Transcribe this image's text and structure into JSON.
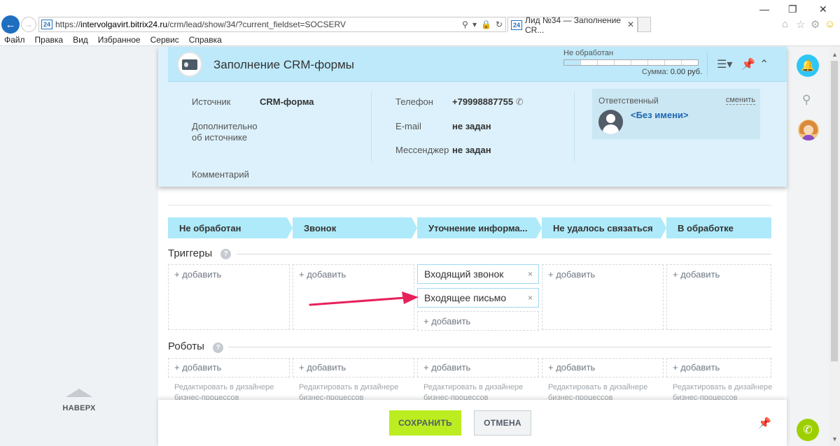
{
  "browser": {
    "url_prefix": "https://",
    "url_host": "intervolgavirt.bitrix24.ru",
    "url_path": "/crm/lead/show/34/?current_fieldset=SOCSERV",
    "favicon_text": "24",
    "tab_title": "Лид №34 — Заполнение CR...",
    "menu": [
      "Файл",
      "Правка",
      "Вид",
      "Избранное",
      "Сервис",
      "Справка"
    ]
  },
  "header": {
    "title": "Заполнение CRM-формы",
    "status_label": "Не обработан",
    "progress_segments": 8,
    "progress_filled": 1,
    "sum_label": "Сумма:",
    "sum_value": "0.00 руб."
  },
  "info": {
    "source_label": "Источник",
    "source_value": "CRM-форма",
    "extra_source_label_1": "Дополнительно",
    "extra_source_label_2": "об источнике",
    "comment_label": "Комментарий",
    "phone_label": "Телефон",
    "phone_value": "+79998887755",
    "email_label": "E-mail",
    "email_value": "не задан",
    "messenger_label": "Мессенджер",
    "messenger_value": "не задан",
    "responsible_title": "Ответственный",
    "responsible_change": "сменить",
    "responsible_name": "<Без имени>"
  },
  "stages": [
    "Не обработан",
    "Звонок",
    "Уточнение информа...",
    "Не удалось связаться",
    "В обработке"
  ],
  "stage_color": "#aeeaf9",
  "triggers": {
    "title": "Триггеры",
    "add_label": "+ добавить",
    "items": [
      "Входящий звонок",
      "Входящее письмо"
    ],
    "remove_glyph": "×"
  },
  "robots": {
    "title": "Роботы",
    "add_label": "+ добавить",
    "hint_1": "Редактировать в дизайнере",
    "hint_2": "бизнес-процессов"
  },
  "help_glyph": "?",
  "footer": {
    "save_label": "СОХРАНИТЬ",
    "cancel_label": "ОТМЕНА",
    "save_color": "#bbed21"
  },
  "scroll_top_label": "НАВЕРХ",
  "accent_arrow_color": "#e8215b"
}
